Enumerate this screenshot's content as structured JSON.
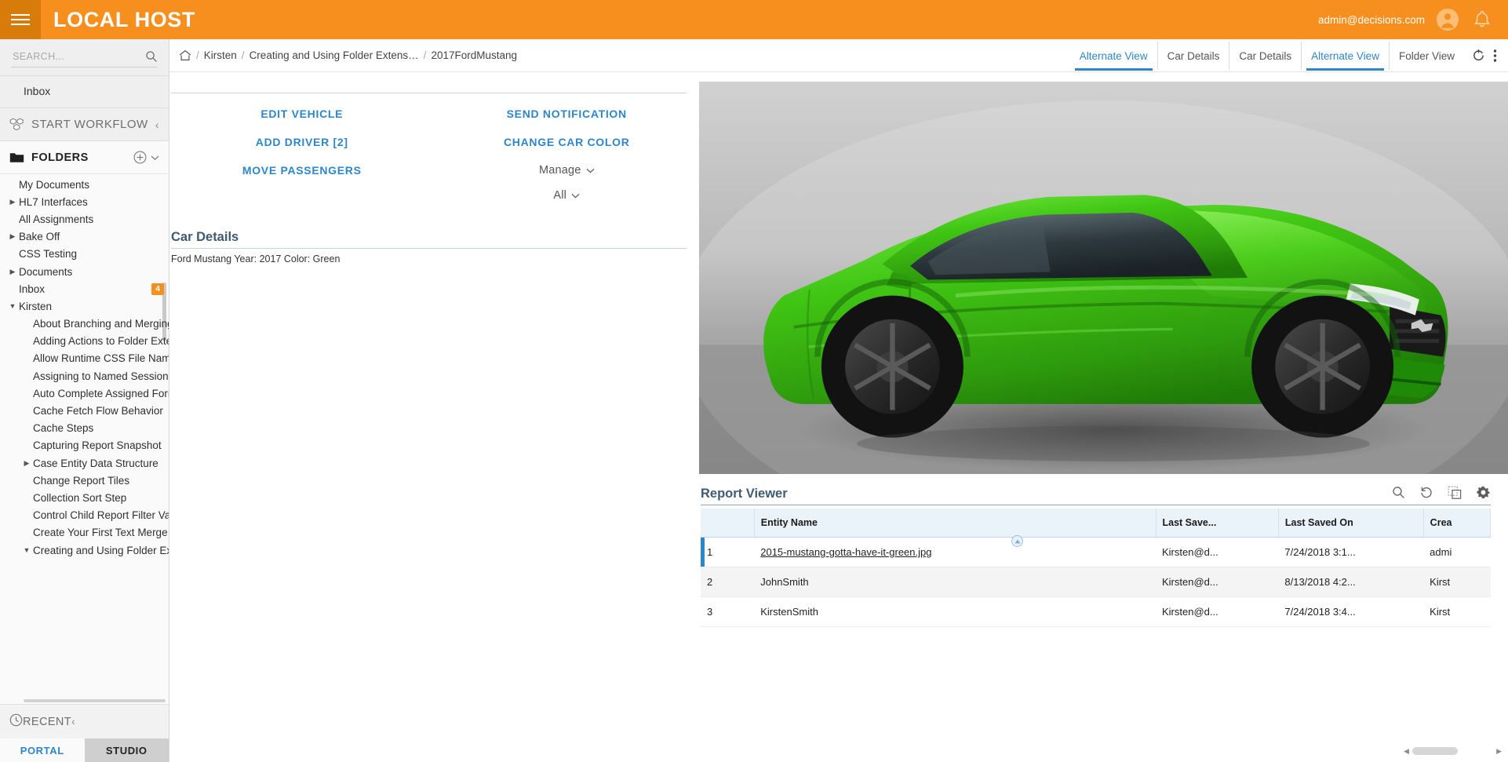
{
  "topbar": {
    "brand": "LOCAL HOST",
    "user_email": "admin@decisions.com",
    "menu_icon": "hamburger-icon",
    "avatar_icon": "user-avatar-icon",
    "bell_icon": "notification-bell-icon",
    "background_color": "#F68F1E"
  },
  "sidebar": {
    "search": {
      "placeholder": "SEARCH...",
      "value": "",
      "icon": "search-icon"
    },
    "inbox_link": "Inbox",
    "start_workflow": {
      "label": "START WORKFLOW",
      "icon": "workflow-blocks-icon",
      "collapse_icon": "chevron-left-icon"
    },
    "folders": {
      "label": "FOLDERS",
      "icon": "folder-icon",
      "add_icon": "plus-circle-icon",
      "chevron_icon": "chevron-down-icon"
    },
    "tree": [
      {
        "label": "My Documents",
        "level": 1,
        "twisty": "none"
      },
      {
        "label": "HL7 Interfaces",
        "level": 1,
        "twisty": "collapsed"
      },
      {
        "label": "All Assignments",
        "level": 1,
        "twisty": "none"
      },
      {
        "label": "Bake Off",
        "level": 1,
        "twisty": "collapsed"
      },
      {
        "label": "CSS Testing",
        "level": 1,
        "twisty": "none"
      },
      {
        "label": "Documents",
        "level": 1,
        "twisty": "collapsed"
      },
      {
        "label": "Inbox",
        "level": 1,
        "twisty": "none",
        "badge": "4"
      },
      {
        "label": "Kirsten",
        "level": 1,
        "twisty": "expanded"
      },
      {
        "label": "About Branching and Merging Fl",
        "level": 2,
        "twisty": "none"
      },
      {
        "label": "Adding Actions to Folder Extens",
        "level": 2,
        "twisty": "none"
      },
      {
        "label": "Allow Runtime CSS File Name",
        "level": 2,
        "twisty": "none"
      },
      {
        "label": "Assigning to Named Sessions",
        "level": 2,
        "twisty": "none"
      },
      {
        "label": "Auto Complete Assigned Form",
        "level": 2,
        "twisty": "none"
      },
      {
        "label": "Cache Fetch Flow Behavior",
        "level": 2,
        "twisty": "none"
      },
      {
        "label": "Cache Steps",
        "level": 2,
        "twisty": "none"
      },
      {
        "label": "Capturing Report Snapshot",
        "level": 2,
        "twisty": "none"
      },
      {
        "label": "Case Entity Data Structure",
        "level": 2,
        "twisty": "collapsed"
      },
      {
        "label": "Change Report Tiles",
        "level": 2,
        "twisty": "none"
      },
      {
        "label": "Collection Sort Step",
        "level": 2,
        "twisty": "none"
      },
      {
        "label": "Control Child Report Filter Value",
        "level": 2,
        "twisty": "none"
      },
      {
        "label": "Create Your First Text Merge",
        "level": 2,
        "twisty": "none"
      },
      {
        "label": "Creating and Using Folder Exten",
        "level": 2,
        "twisty": "expanded"
      }
    ],
    "recent": {
      "label": "RECENT",
      "icon": "clock-icon",
      "collapse_icon": "chevron-left-icon"
    },
    "bottom_tabs": [
      {
        "label": "PORTAL",
        "active": true
      },
      {
        "label": "STUDIO",
        "active": false
      }
    ]
  },
  "breadcrumb": {
    "home_icon": "home-icon",
    "items": [
      "Kirsten",
      "Creating and Using Folder Extens…",
      "2017FordMustang"
    ]
  },
  "view_tabs": [
    {
      "label": "Alternate View",
      "active": true
    },
    {
      "label": "Car Details",
      "active": false
    },
    {
      "label": "Car Details",
      "active": false
    },
    {
      "label": "Alternate View",
      "active": true
    },
    {
      "label": "Folder View",
      "active": false
    }
  ],
  "view_tab_icons": [
    {
      "name": "refresh-icon"
    },
    {
      "name": "kebab-menu-icon"
    }
  ],
  "actions": {
    "column_left": [
      "EDIT VEHICLE",
      "ADD DRIVER [2]",
      "MOVE PASSENGERS"
    ],
    "column_right": [
      "SEND NOTIFICATION",
      "CHANGE CAR COLOR"
    ],
    "dropdowns": [
      {
        "label": "Manage",
        "icon": "chevron-down-icon"
      },
      {
        "label": "All",
        "icon": "chevron-down-icon"
      }
    ]
  },
  "car_details_card": {
    "title": "Car Details",
    "text": "Ford Mustang Year: 2017 Color: Green"
  },
  "car_photo": {
    "alt": "green-ford-mustang-photo",
    "body_color": "#3FC215"
  },
  "report_viewer": {
    "title": "Report Viewer",
    "toolbar_icons": [
      {
        "name": "search-icon"
      },
      {
        "name": "refresh-icon"
      },
      {
        "name": "copy-icon"
      },
      {
        "name": "gear-icon"
      }
    ],
    "columns": [
      "",
      "Entity Name",
      "Last Save...",
      "Last Saved On",
      "Crea"
    ],
    "rows": [
      {
        "index": "1",
        "entity_name": "2015-mustang-gotta-have-it-green.jpg",
        "entity_is_link": true,
        "last_saved_by": "Kirsten@d...",
        "last_saved_on": "7/24/2018 3:1...",
        "created_by": "admi",
        "selected": true
      },
      {
        "index": "2",
        "entity_name": "JohnSmith",
        "entity_is_link": false,
        "last_saved_by": "Kirsten@d...",
        "last_saved_on": "8/13/2018 4:2...",
        "created_by": "Kirst",
        "selected": false
      },
      {
        "index": "3",
        "entity_name": "KirstenSmith",
        "entity_is_link": false,
        "last_saved_by": "Kirsten@d...",
        "last_saved_on": "7/24/2018 3:4...",
        "created_by": "Kirst",
        "selected": false
      }
    ],
    "sort_marker_icon": "sort-ascending-icon",
    "hscroll": {
      "left_arrow": "◀",
      "right_arrow": "▶"
    }
  }
}
